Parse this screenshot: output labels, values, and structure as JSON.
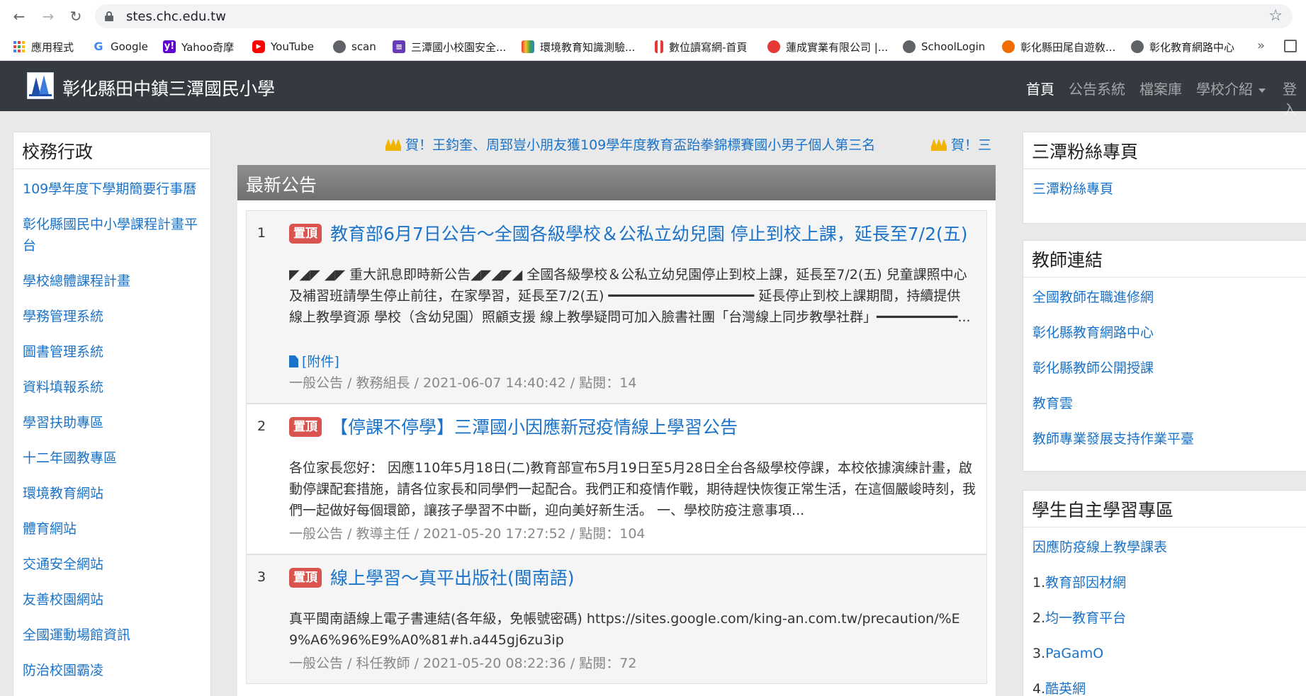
{
  "browser": {
    "url": "stes.chc.edu.tw",
    "bookmarks": [
      {
        "icon": "apps-grid-icon",
        "label": "應用程式"
      },
      {
        "icon": "google-icon",
        "label": "Google"
      },
      {
        "icon": "yahoo-icon",
        "label": "Yahoo奇摩"
      },
      {
        "icon": "youtube-icon",
        "label": "YouTube"
      },
      {
        "icon": "globe-icon",
        "label": "scan"
      },
      {
        "icon": "list-icon",
        "label": "三潭國小校園安全..."
      },
      {
        "icon": "rainbow-icon",
        "label": "環境教育知識測驗..."
      },
      {
        "icon": "bars-icon",
        "label": "數位讀寫網-首頁"
      },
      {
        "icon": "swirl-icon",
        "label": "蓮成實業有限公司 |..."
      },
      {
        "icon": "globe-icon",
        "label": "SchoolLogin"
      },
      {
        "icon": "circle-icon",
        "label": "彰化縣田尾自遊敎..."
      },
      {
        "icon": "globe-icon",
        "label": "彰化教育網路中心"
      }
    ],
    "more": "»"
  },
  "site": {
    "brand": "彰化縣田中鎮三潭國民小學",
    "nav": [
      "首頁",
      "公告系統",
      "檔案庫",
      "學校介紹",
      "登入"
    ]
  },
  "left_sidebar": {
    "title": "校務行政",
    "links": [
      "109學年度下學期簡要行事曆",
      "彰化縣國民中小學課程計畫平台",
      "學校總體課程計畫",
      "學務管理系統",
      "圖書管理系統",
      "資料填報系統",
      "學習扶助專區",
      "十二年國教專區",
      "環境教育網站",
      "體育網站",
      "交通安全網站",
      "友善校園網站",
      "全國運動場館資訊",
      "防治校園霸凌"
    ]
  },
  "marquee": [
    "賀！王鈞奎、周郅豈小朋友獲109學年度教育盃跆拳錦標賽國小男子個人第三名",
    "賀！三"
  ],
  "news": {
    "header": "最新公告",
    "pin_label": "置頂",
    "attach_label": "[附件]",
    "items": [
      {
        "num": "1",
        "title": "教育部6月7日公告～全國各級學校＆公私立幼兒園 停止到校上課，延長至7/2(五)",
        "text": "◤◢◤ ◢◤ 重大訊息即時新公告◢◤◢◤◢ 全國各級學校＆公私立幼兒園停止到校上課，延長至7/2(五) 兒童課照中心及補習班請學生停止前往，在家學習，延長至7/2(五) ━━━━━━━━━━━━━━━━━━ 延長停止到校上課期間，持續提供 線上教學資源 學校（含幼兒園）照顧支援 線上教學疑問可加入臉書社團「台灣線上同步教學社群」━━━━━━━━━━...",
        "meta": "一般公告 / 教務組長 / 2021-06-07 14:40:42 / 點閱：14"
      },
      {
        "num": "2",
        "title": "【停課不停學】三潭國小因應新冠疫情線上學習公告",
        "text": "各位家長您好： 因應110年5月18日(二)教育部宣布5月19日至5月28日全台各級學校停課，本校依據演練計畫，啟動停課配套措施，請各位家長和同學們一起配合。我們正和疫情作戰，期待趕快恢復正常生活，在這個嚴峻時刻，我們一起做好每個環節，讓孩子學習不中斷，迎向美好新生活。 一、學校防疫注意事項...",
        "meta": "一般公告 / 教導主任 / 2021-05-20 17:27:52 / 點閱：104"
      },
      {
        "num": "3",
        "title": "線上學習～真平出版社(閩南語)",
        "text": "真平閩南語線上電子書連結(各年級，免帳號密碼) https://sites.google.com/king-an.com.tw/precaution/%E9%A6%96%E9%A0%81#h.a445gj6zu3ip",
        "meta": "一般公告 / 科任教師 / 2021-05-20 08:22:36 / 點閱：72"
      }
    ]
  },
  "right_sidebar": {
    "fans": {
      "title": "三潭粉絲專頁",
      "links": [
        "三潭粉絲專頁"
      ]
    },
    "teachers": {
      "title": "教師連結",
      "links": [
        "全國教師在職進修網",
        "彰化縣教育網路中心",
        "彰化縣教師公開授課",
        "教育雲",
        "教師專業發展支持作業平臺"
      ]
    },
    "students": {
      "title": "學生自主學習專區",
      "links": [
        {
          "num": "",
          "label": "因應防疫線上教學課表"
        },
        {
          "num": "1.",
          "label": "教育部因材網"
        },
        {
          "num": "2.",
          "label": "均一教育平台"
        },
        {
          "num": "3.",
          "label": "PaGamO"
        },
        {
          "num": "4.",
          "label": "酷英網"
        }
      ]
    }
  }
}
